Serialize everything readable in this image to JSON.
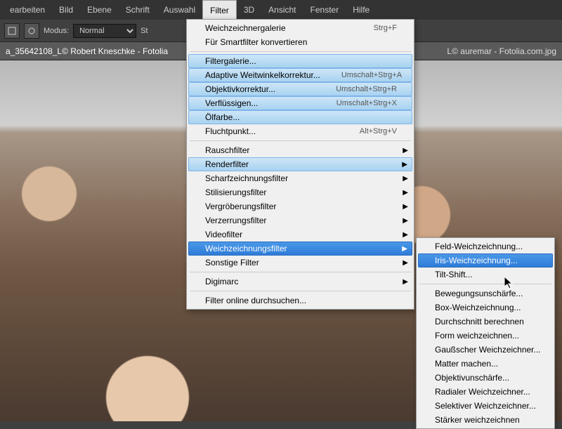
{
  "menubar": [
    "earbeiten",
    "Bild",
    "Ebene",
    "Schrift",
    "Auswahl",
    "Filter",
    "3D",
    "Ansicht",
    "Fenster",
    "Hilfe"
  ],
  "menubar_active": 5,
  "toolbar": {
    "modus_label": "Modus:",
    "modus_value": "Normal",
    "st_label": "St"
  },
  "tabs": [
    "a_35642108_L© Robert Kneschke - Fotolia",
    "L© auremar - Fotolia.com.jpg"
  ],
  "filter_menu": [
    {
      "label": "Weichzeichnergalerie",
      "shortcut": "Strg+F"
    },
    {
      "label": "Für Smartfilter konvertieren"
    },
    {
      "sep": true
    },
    {
      "label": "Filtergalerie...",
      "hl": true
    },
    {
      "label": "Adaptive Weitwinkelkorrektur...",
      "shortcut": "Umschalt+Strg+A",
      "hl": true
    },
    {
      "label": "Objektivkorrektur...",
      "shortcut": "Umschalt+Strg+R",
      "hl": true
    },
    {
      "label": "Verflüssigen...",
      "shortcut": "Umschalt+Strg+X",
      "hl": true
    },
    {
      "label": "Ölfarbe...",
      "hl": true
    },
    {
      "label": "Fluchtpunkt...",
      "shortcut": "Alt+Strg+V"
    },
    {
      "sep": true
    },
    {
      "label": "Rauschfilter",
      "sub": true
    },
    {
      "label": "Renderfilter",
      "sub": true,
      "hl": true
    },
    {
      "label": "Scharfzeichnungsfilter",
      "sub": true
    },
    {
      "label": "Stilisierungsfilter",
      "sub": true
    },
    {
      "label": "Vergröberungsfilter",
      "sub": true
    },
    {
      "label": "Verzerrungsfilter",
      "sub": true
    },
    {
      "label": "Videofilter",
      "sub": true
    },
    {
      "label": "Weichzeichnungsfilter",
      "sub": true,
      "sel": true
    },
    {
      "label": "Sonstige Filter",
      "sub": true
    },
    {
      "sep": true
    },
    {
      "label": "Digimarc",
      "sub": true
    },
    {
      "sep": true
    },
    {
      "label": "Filter online durchsuchen..."
    }
  ],
  "blur_submenu": [
    {
      "label": "Feld-Weichzeichnung..."
    },
    {
      "label": "Iris-Weichzeichnung...",
      "sel": true
    },
    {
      "label": "Tilt-Shift..."
    },
    {
      "sep": true
    },
    {
      "label": "Bewegungsunschärfe..."
    },
    {
      "label": "Box-Weichzeichnung..."
    },
    {
      "label": "Durchschnitt berechnen"
    },
    {
      "label": "Form weichzeichnen..."
    },
    {
      "label": "Gaußscher Weichzeichner..."
    },
    {
      "label": "Matter machen..."
    },
    {
      "label": "Objektivunschärfe..."
    },
    {
      "label": "Radialer Weichzeichner..."
    },
    {
      "label": "Selektiver Weichzeichner..."
    },
    {
      "label": "Stärker weichzeichnen"
    }
  ]
}
